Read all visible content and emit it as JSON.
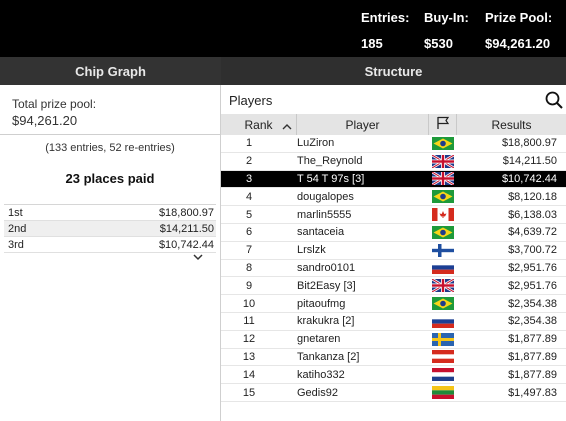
{
  "header": {
    "entries_label": "Entries:",
    "entries_value": "185",
    "buyin_label": "Buy-In:",
    "buyin_value": "$530",
    "prize_label": "Prize Pool:",
    "prize_value": "$94,261.20"
  },
  "tabs": [
    {
      "label": "Chip Graph"
    },
    {
      "label": "Structure"
    }
  ],
  "summary": {
    "prize_label": "Total prize pool:",
    "prize_value": "$94,261.20",
    "entries_note": "(133 entries, 52 re-entries)",
    "places_paid": "23 places paid",
    "payouts": [
      {
        "place": "1st",
        "amount": "$18,800.97"
      },
      {
        "place": "2nd",
        "amount": "$14,211.50"
      },
      {
        "place": "3rd",
        "amount": "$10,742.44"
      }
    ]
  },
  "players": {
    "title": "Players",
    "columns": {
      "rank": "Rank",
      "player": "Player",
      "results": "Results"
    },
    "rows": [
      {
        "rank": "1",
        "name": "LuZiron",
        "country": "brazil",
        "result": "$18,800.97"
      },
      {
        "rank": "2",
        "name": "The_Reynold",
        "country": "uk",
        "result": "$14,211.50"
      },
      {
        "rank": "3",
        "name": "T 54 T 97s [3]",
        "country": "uk",
        "result": "$10,742.44",
        "selected": true
      },
      {
        "rank": "4",
        "name": "dougalopes",
        "country": "brazil",
        "result": "$8,120.18"
      },
      {
        "rank": "5",
        "name": "marlin5555",
        "country": "canada",
        "result": "$6,138.03"
      },
      {
        "rank": "6",
        "name": "santaceia",
        "country": "brazil",
        "result": "$4,639.72"
      },
      {
        "rank": "7",
        "name": "Lrslzk",
        "country": "finland",
        "result": "$3,700.72"
      },
      {
        "rank": "8",
        "name": "sandro0101",
        "country": "russia",
        "result": "$2,951.76"
      },
      {
        "rank": "9",
        "name": "Bit2Easy [3]",
        "country": "uk",
        "result": "$2,951.76"
      },
      {
        "rank": "10",
        "name": "pitaoufmg",
        "country": "brazil",
        "result": "$2,354.38"
      },
      {
        "rank": "11",
        "name": "krakukra [2]",
        "country": "russia",
        "result": "$2,354.38"
      },
      {
        "rank": "12",
        "name": "gnetaren",
        "country": "sweden",
        "result": "$1,877.89"
      },
      {
        "rank": "13",
        "name": "Tankanza [2]",
        "country": "austria",
        "result": "$1,877.89"
      },
      {
        "rank": "14",
        "name": "katiho332",
        "country": "netherlands",
        "result": "$1,877.89"
      },
      {
        "rank": "15",
        "name": "Gedis92",
        "country": "lithuania",
        "result": "$1,497.83"
      }
    ]
  },
  "icons": {
    "search": "search-icon",
    "sort": "chevron-up-icon",
    "flag_header": "flag-icon",
    "more": "chevron-down-icon"
  }
}
